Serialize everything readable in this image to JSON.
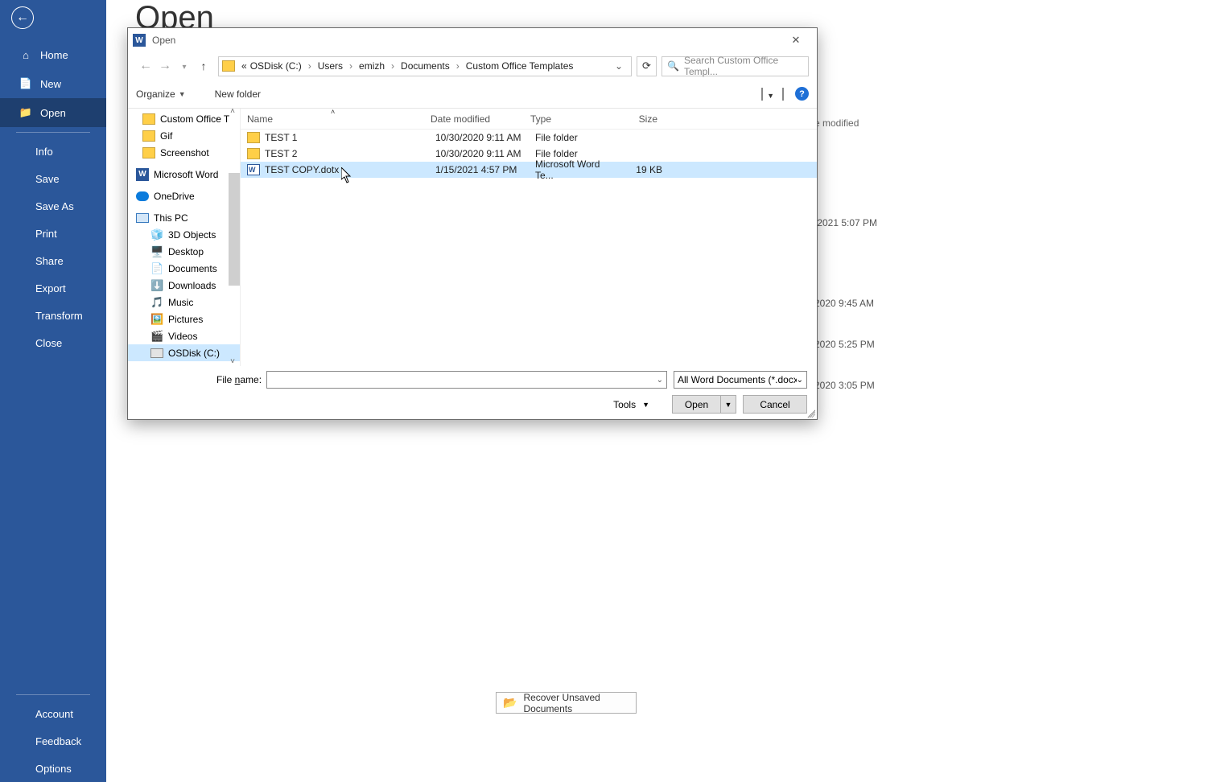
{
  "sidebar": {
    "home": "Home",
    "new": "New",
    "open": "Open",
    "info": "Info",
    "save": "Save",
    "saveas": "Save As",
    "print": "Print",
    "share": "Share",
    "export": "Export",
    "transform": "Transform",
    "close": "Close",
    "account": "Account",
    "feedback": "Feedback",
    "options": "Options"
  },
  "page": {
    "title": "Open"
  },
  "bg": {
    "col_header": "e modified",
    "r1": "/2021 5:07 PM",
    "r2": "2020 9:45 AM",
    "r3": "2020 5:25 PM",
    "r4": "2020 3:05 PM"
  },
  "recover_btn": "Recover Unsaved Documents",
  "dialog": {
    "title": "Open",
    "breadcrumb": {
      "prefix": "«",
      "parts": [
        "OSDisk (C:)",
        "Users",
        "emizh",
        "Documents",
        "Custom Office Templates"
      ]
    },
    "search_placeholder": "Search Custom Office Templ...",
    "organize": "Organize",
    "new_folder": "New folder",
    "tree": {
      "cot": "Custom Office T",
      "gif": "Gif",
      "screenshot": "Screenshot",
      "word": "Microsoft Word",
      "onedrive": "OneDrive",
      "thispc": "This PC",
      "objects3d": "3D Objects",
      "desktop": "Desktop",
      "documents": "Documents",
      "downloads": "Downloads",
      "music": "Music",
      "pictures": "Pictures",
      "videos": "Videos",
      "osdisk": "OSDisk (C:)"
    },
    "columns": {
      "name": "Name",
      "date": "Date modified",
      "type": "Type",
      "size": "Size"
    },
    "rows": [
      {
        "name": "TEST 1",
        "date": "10/30/2020 9:11 AM",
        "type": "File folder",
        "size": "",
        "kind": "folder"
      },
      {
        "name": "TEST 2",
        "date": "10/30/2020 9:11 AM",
        "type": "File folder",
        "size": "",
        "kind": "folder"
      },
      {
        "name": "TEST COPY.dotx",
        "date": "1/15/2021 4:57 PM",
        "type": "Microsoft Word Te...",
        "size": "19 KB",
        "kind": "docx"
      }
    ],
    "file_name_label_prefix": "File ",
    "file_name_label_underlined": "n",
    "file_name_label_suffix": "ame:",
    "file_name_value": "",
    "filter": "All Word Documents (*.docx;*.",
    "tools": "Tools",
    "open_btn": "Open",
    "cancel_btn": "Cancel"
  }
}
